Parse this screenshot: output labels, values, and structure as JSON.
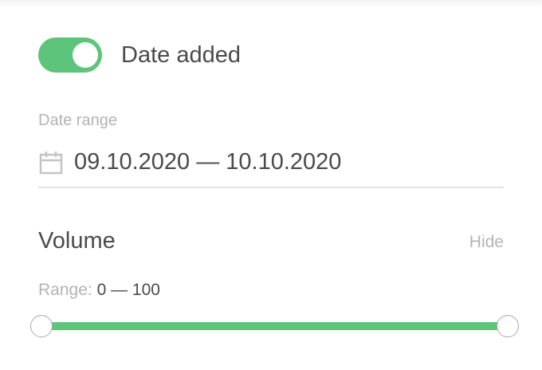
{
  "filters": {
    "date_added": {
      "label": "Date added",
      "enabled": true,
      "accent_color": "#5dc47b"
    },
    "date_range": {
      "label": "Date range",
      "value": "09.10.2020 — 10.10.2020",
      "icon": "calendar-icon"
    },
    "volume": {
      "title": "Volume",
      "hide_label": "Hide",
      "range_label": "Range:",
      "range_value": "0 — 100",
      "min": 0,
      "max": 100,
      "selected_min": 0,
      "selected_max": 100
    }
  }
}
